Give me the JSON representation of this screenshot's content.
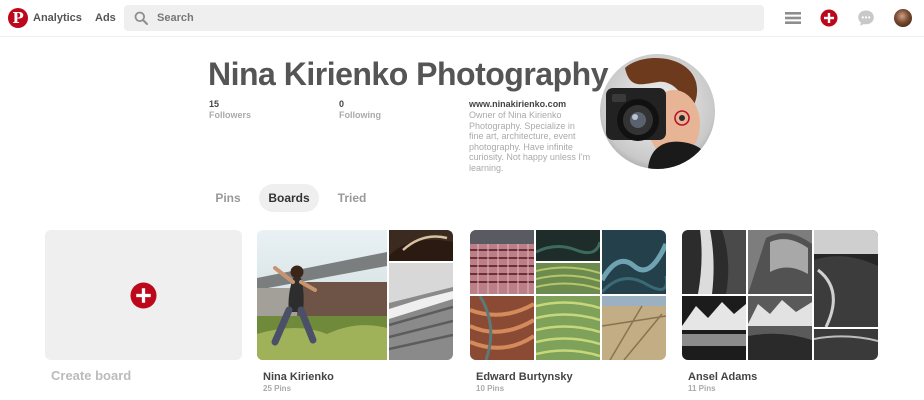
{
  "nav": {
    "logo_letter": "P",
    "analytics": "Analytics",
    "ads": "Ads",
    "search_placeholder": "Search",
    "brand_color": "#bd081c"
  },
  "profile": {
    "name": "Nina Kirienko Photography",
    "followers_count": "15",
    "followers_label": "Followers",
    "following_count": "0",
    "following_label": "Following",
    "website": "www.ninakirienko.com",
    "bio": "Owner of Nina Kirienko Photography. Specialize in fine art, architecture, event photography. Have infinite curiosity. Not happy unless I'm learning."
  },
  "tabs": [
    {
      "label": "Pins",
      "active": false
    },
    {
      "label": "Boards",
      "active": true
    },
    {
      "label": "Tried",
      "active": false
    }
  ],
  "create_board": {
    "label": "Create board"
  },
  "boards": [
    {
      "title": "Nina Kirienko",
      "pins": "25 Pins"
    },
    {
      "title": "Edward Burtynsky",
      "pins": "10 Pins"
    },
    {
      "title": "Ansel Adams",
      "pins": "11 Pins"
    }
  ],
  "icons": [
    "pinterest-logo-icon",
    "search-icon",
    "menu-icon",
    "create-pin-icon",
    "messages-icon",
    "user-avatar",
    "profile-photo",
    "add-board-icon"
  ]
}
